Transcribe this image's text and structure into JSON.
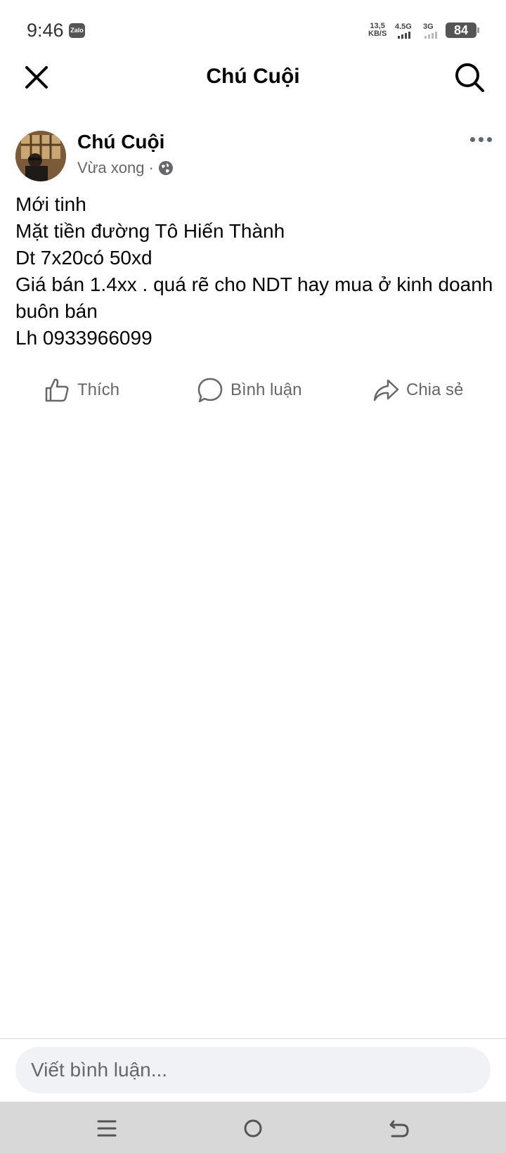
{
  "status_bar": {
    "time": "9:46",
    "app_badge": "Zalo",
    "net_speed_value": "13,5",
    "net_speed_unit": "KB/S",
    "signal_1_label": "4.5G",
    "signal_2_label": "3G",
    "battery_level": "84"
  },
  "header": {
    "title": "Chú Cuội",
    "close_icon": "close-icon",
    "search_icon": "search-icon"
  },
  "post": {
    "author": "Chú Cuội",
    "time": "Vừa xong",
    "separator": "·",
    "privacy_icon": "globe-icon",
    "lines": [
      "Mới tinh",
      "Mặt tiền đường Tô Hiến Thành",
      "Dt 7x20có 50xd",
      "Giá bán 1.4xx . quá rẽ cho NDT hay mua ở kinh doanh buôn bán",
      "Lh 0933966099"
    ]
  },
  "actions": {
    "like": "Thích",
    "comment": "Bình luận",
    "share": "Chia sẻ"
  },
  "comment_box": {
    "placeholder": "Viết bình luận..."
  },
  "colors": {
    "text": "#050505",
    "secondary": "#65676b",
    "input_bg": "#f0f2f5",
    "nav_bar": "#d8d8d8"
  }
}
